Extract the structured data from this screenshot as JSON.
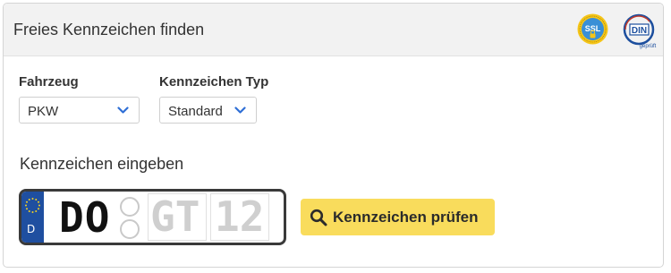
{
  "header": {
    "title": "Freies Kennzeichen finden",
    "ssl_badge": {
      "icon": "ssl-seal-icon",
      "label": "SSL",
      "ring_text": "SSL VERSCHLÜSSELT SICHERHEITSSTANDARD",
      "color": "#f5c518",
      "inner_color": "#3a8fd6"
    },
    "din_badge": {
      "icon": "din-certified-icon",
      "label": "DIN",
      "sub": "geprüft",
      "color": "#1d4f9e"
    }
  },
  "filters": {
    "vehicle": {
      "label": "Fahrzeug",
      "value": "PKW",
      "icon": "chevron-down-icon"
    },
    "plate_type": {
      "label": "Kennzeichen Typ",
      "value": "Standard",
      "icon": "chevron-down-icon"
    }
  },
  "plate_section": {
    "title": "Kennzeichen eingeben",
    "eu_country": "D",
    "city": "DO",
    "letters_placeholder": "GT",
    "digits_placeholder": "12",
    "eu_color": "#1f4fa0"
  },
  "check_button": {
    "label": "Kennzeichen prüfen",
    "icon": "search-icon",
    "color": "#f9dc5c"
  },
  "colors": {
    "accent_chevron": "#2f6fd6",
    "header_bg": "#f2f2f2"
  }
}
